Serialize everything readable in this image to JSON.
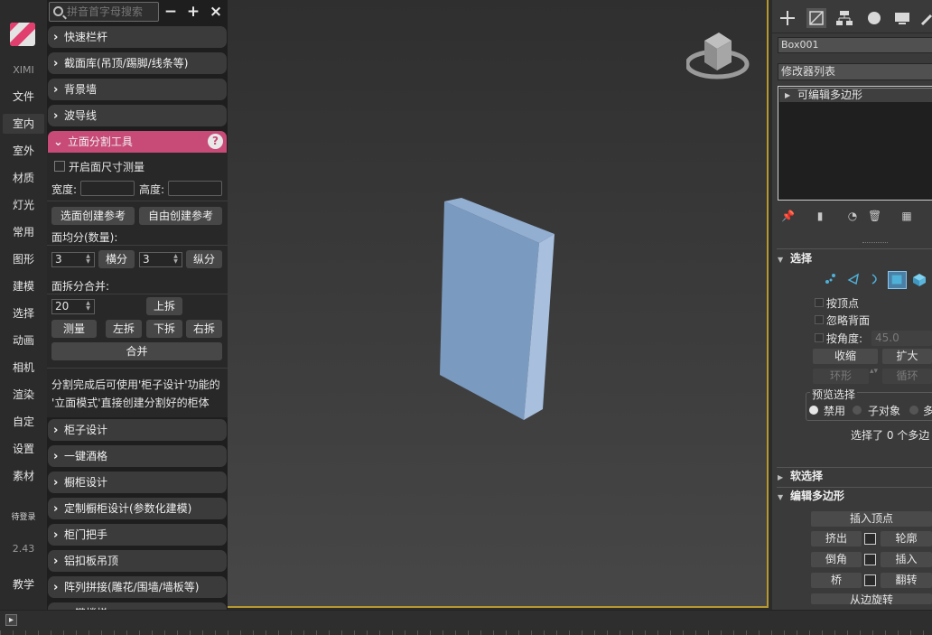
{
  "nav": {
    "brand": "XIMI",
    "items": [
      "文件",
      "室内",
      "室外",
      "材质",
      "灯光",
      "常用",
      "图形",
      "建模",
      "选择",
      "动画",
      "相机",
      "渲染",
      "自定",
      "设置",
      "素材"
    ],
    "active_index": 1,
    "login": "待登录",
    "version": "2.43",
    "teach": "教学"
  },
  "panel": {
    "search_placeholder": "拼音首字母搜索",
    "minus": "−",
    "plus": "+",
    "close": "×",
    "sections_before": [
      "快速栏杆",
      "截面库(吊顶/踢脚/线条等)",
      "背景墙",
      "波导线"
    ],
    "open_section": "立面分割工具",
    "help": "?",
    "open_body": {
      "measure_checkbox": "开启面尺寸测量",
      "measure_checked": false,
      "width_label": "宽度:",
      "height_label": "高度:",
      "width_value": "",
      "height_value": "",
      "btn_select_face_ref": "选面创建参考",
      "btn_free_ref": "自由创建参考",
      "split_label": "面均分(数量):",
      "h_count": "3",
      "btn_h_split": "横分",
      "v_count": "3",
      "btn_v_split": "纵分",
      "split_merge_label": "面拆分合并:",
      "split_value": "20",
      "btn_up": "上拆",
      "btn_measure": "测量",
      "btn_left": "左拆",
      "btn_down": "下拆",
      "btn_right": "右拆",
      "btn_merge": "合并",
      "note_line1": "分割完成后可使用'柜子设计'功能的",
      "note_line2": "'立面模式'直接创建分割好的柜体"
    },
    "sections_after": [
      "柜子设计",
      "一键酒格",
      "橱柜设计",
      "定制橱柜设计(参数化建模)",
      "柜门把手",
      "铝扣板吊顶",
      "阵列拼接(雕花/围墙/墙板等)",
      "一键楼梯"
    ]
  },
  "command_panel": {
    "object_name": "Box001",
    "modifier_list": "修改器列表",
    "stack_item": "可编辑多边形",
    "selection": {
      "header": "选择",
      "by_vertex": "按顶点",
      "ignore_backface": "忽略背面",
      "by_angle": "按角度:",
      "angle_value": "45.0",
      "shrink": "收缩",
      "grow": "扩大",
      "ring": "环形",
      "loop": "循环",
      "preview_title": "预览选择",
      "preview_options": [
        "禁用",
        "子对象",
        "多"
      ],
      "preview_selected": 0,
      "status": "选择了 0 个多边"
    },
    "soft_selection": "软选择",
    "edit_poly": {
      "header": "编辑多边形",
      "insert_vertex": "插入顶点",
      "extrude": "挤出",
      "outline": "轮廓",
      "bevel": "倒角",
      "inset": "插入",
      "bridge": "桥",
      "flip": "翻转",
      "hinge": "从边旋转"
    }
  },
  "colors": {
    "accent": "#c74a77",
    "viewport_border": "#b8992f",
    "box": "#7b9ac0"
  }
}
